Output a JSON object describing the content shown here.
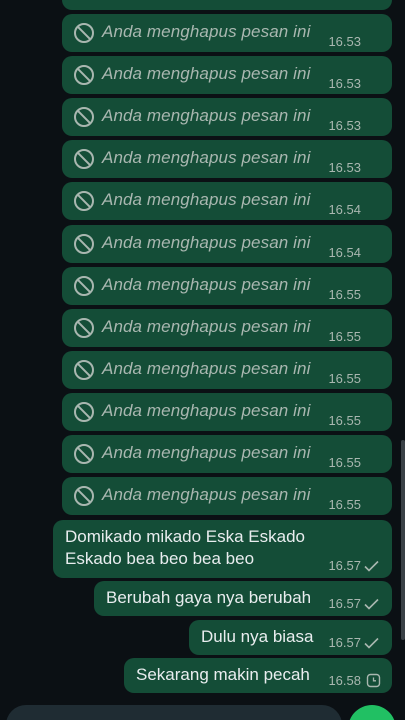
{
  "messages": {
    "deleted": [
      {
        "text": "Anda menghapus pesan ini",
        "time": "16.53"
      },
      {
        "text": "Anda menghapus pesan ini",
        "time": "16.53"
      },
      {
        "text": "Anda menghapus pesan ini",
        "time": "16.53"
      },
      {
        "text": "Anda menghapus pesan ini",
        "time": "16.53"
      },
      {
        "text": "Anda menghapus pesan ini",
        "time": "16.54"
      },
      {
        "text": "Anda menghapus pesan ini",
        "time": "16.54"
      },
      {
        "text": "Anda menghapus pesan ini",
        "time": "16.55"
      },
      {
        "text": "Anda menghapus pesan ini",
        "time": "16.55"
      },
      {
        "text": "Anda menghapus pesan ini",
        "time": "16.55"
      },
      {
        "text": "Anda menghapus pesan ini",
        "time": "16.55"
      },
      {
        "text": "Anda menghapus pesan ini",
        "time": "16.55"
      },
      {
        "text": "Anda menghapus pesan ini",
        "time": "16.55"
      }
    ],
    "sent": [
      {
        "line1": "Domikado mikado Eska Eskado",
        "line2": "Eskado bea beo bea beo",
        "time": "16.57",
        "status": "sent-check-icon"
      },
      {
        "line1": "Berubah gaya nya berubah",
        "time": "16.57",
        "status": "sent-check-icon"
      },
      {
        "line1": "Dulu nya biasa",
        "time": "16.57",
        "status": "sent-check-icon"
      },
      {
        "line1": "Sekarang makin pecah",
        "time": "16.58",
        "status": "pending-clock-icon"
      }
    ]
  },
  "colors": {
    "background": "#0b1014",
    "outgoing_bubble": "#144d37",
    "muted_text": "#a9b7b0",
    "accent": "#21c063"
  }
}
